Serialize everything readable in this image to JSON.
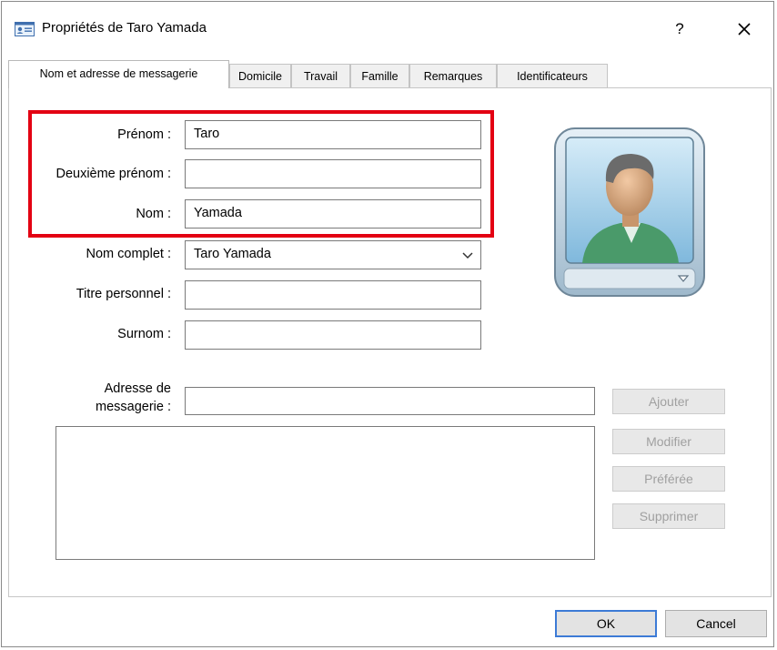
{
  "window": {
    "title": "Propriétés de Taro Yamada",
    "help_label": "?",
    "icons": {
      "title": "contact-card-icon",
      "close": "close-icon",
      "dropdown": "chevron-down-icon",
      "avatar_menu": "triangle-down-icon"
    }
  },
  "tabs": [
    {
      "label": "Nom et adresse de messagerie",
      "active": true
    },
    {
      "label": "Domicile",
      "active": false
    },
    {
      "label": "Travail",
      "active": false
    },
    {
      "label": "Famille",
      "active": false
    },
    {
      "label": "Remarques",
      "active": false
    },
    {
      "label": "Identificateurs",
      "active": false
    }
  ],
  "form": {
    "first_name": {
      "label": "Prénom :",
      "value": "Taro"
    },
    "middle_name": {
      "label": "Deuxième prénom :",
      "value": ""
    },
    "last_name": {
      "label": "Nom :",
      "value": "Yamada"
    },
    "full_name": {
      "label": "Nom complet :",
      "value": "Taro Yamada"
    },
    "personal_title": {
      "label": "Titre personnel :",
      "value": ""
    },
    "nickname": {
      "label": "Surnom :",
      "value": ""
    },
    "email": {
      "label_line1": "Adresse de",
      "label_line2": "messagerie :",
      "value": ""
    }
  },
  "email_buttons": {
    "add": "Ajouter",
    "edit": "Modifier",
    "preferred": "Préférée",
    "delete": "Supprimer"
  },
  "footer": {
    "ok": "OK",
    "cancel": "Cancel"
  },
  "colors": {
    "highlight_box": "#e30012",
    "disabled_text": "#a0a0a0"
  }
}
